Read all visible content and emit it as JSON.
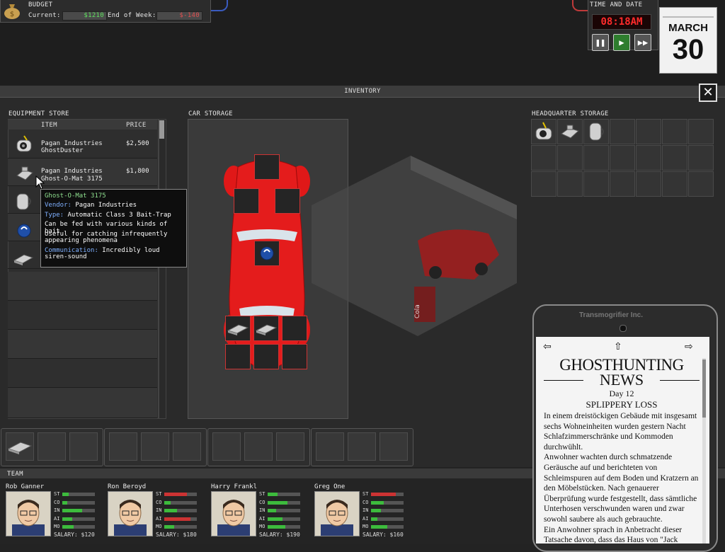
{
  "budget": {
    "title": "BUDGET",
    "current_label": "Current:",
    "current_value": "$1210",
    "eow_label": "End of Week:",
    "eow_value": "$-140"
  },
  "time": {
    "title": "TIME AND DATE",
    "clock": "08:18AM",
    "month": "MARCH",
    "day": "30"
  },
  "inventory": {
    "title": "INVENTORY",
    "store": {
      "title": "EQUIPMENT STORE",
      "col_item": "ITEM",
      "col_price": "PRICE",
      "items": [
        {
          "vendor": "Pagan Industries",
          "name": "GhostDuster",
          "price": "$2,500",
          "icon": "ghostduster-icon"
        },
        {
          "vendor": "Pagan Industries",
          "name": "Ghost-O-Mat 3175",
          "price": "$1,800",
          "icon": "ghost-o-mat-icon"
        },
        {
          "vendor": "",
          "name": "",
          "price": "",
          "icon": "vacuum-pack-icon"
        },
        {
          "vendor": "",
          "name": "",
          "price": "",
          "icon": "blue-sensor-icon"
        },
        {
          "vendor": "",
          "name": "",
          "price": "",
          "icon": "trap-plate-icon"
        }
      ]
    },
    "car": {
      "title": "CAR STORAGE"
    },
    "hq": {
      "title": "HEADQUARTER STORAGE"
    }
  },
  "tooltip": {
    "title": "Ghost-O-Mat 3175",
    "vendor_key": "Vendor:",
    "vendor_val": "Pagan Industries",
    "type_key": "Type:",
    "type_val": "Automatic Class 3 Bait-Trap",
    "desc1": "Can be fed with various kinds of bait",
    "desc2a": "Useful for catching infrequently",
    "desc2b": "appearing phenomena",
    "comm_key": "Communication:",
    "comm_val": "Incredibly loud",
    "comm_val2": "siren-sound"
  },
  "team": {
    "title": "TEAM",
    "stat_labels": [
      "ST",
      "CO",
      "IN",
      "AI",
      "MO"
    ],
    "members": [
      {
        "name": "Rob Ganner",
        "salary": "SALARY: $120",
        "stats": [
          0.2,
          0.15,
          0.6,
          0.3,
          0.35
        ]
      },
      {
        "name": "Ron Beroyd",
        "salary": "SALARY: $180",
        "stats": [
          0.7,
          0.2,
          0.4,
          0.8,
          0.3
        ]
      },
      {
        "name": "Harry Frankl",
        "salary": "SALARY: $190",
        "stats": [
          0.3,
          0.6,
          0.25,
          0.45,
          0.55
        ]
      },
      {
        "name": "Greg One",
        "salary": "SALARY: $160",
        "stats": [
          0.75,
          0.4,
          0.3,
          0.2,
          0.5
        ]
      }
    ]
  },
  "phone": {
    "brand": "Transmogrifier Inc.",
    "masthead1": "GHOSTHUNTING",
    "masthead2": "NEWS",
    "day": "Day 12",
    "headline": "SPLIPPERY LOSS",
    "body": [
      "In einem dreistöckigen Gebäude mit insgesamt sechs Wohneinheiten wurden gestern Nacht Schlafzimmerschränke und Kommoden durchwühlt.",
      "Anwohner wachten durch schmatzende Geräusche auf und berichteten von Schleimspuren auf dem Boden und Kratzern an den Möbelstücken. Nach genauerer Überprüfung wurde festgestellt, dass sämtliche Unterhosen verschwunden waren und zwar sowohl saubere als auch gebrauchte.",
      "Ein Anwohner sprach in Anbetracht dieser Tatsache davon, dass das Haus von \"Jack"
    ]
  },
  "colors": {
    "accent_green": "#5fe05f",
    "accent_red": "#e05050",
    "car_red": "#e01818",
    "clock_red": "#ff2b2b"
  }
}
